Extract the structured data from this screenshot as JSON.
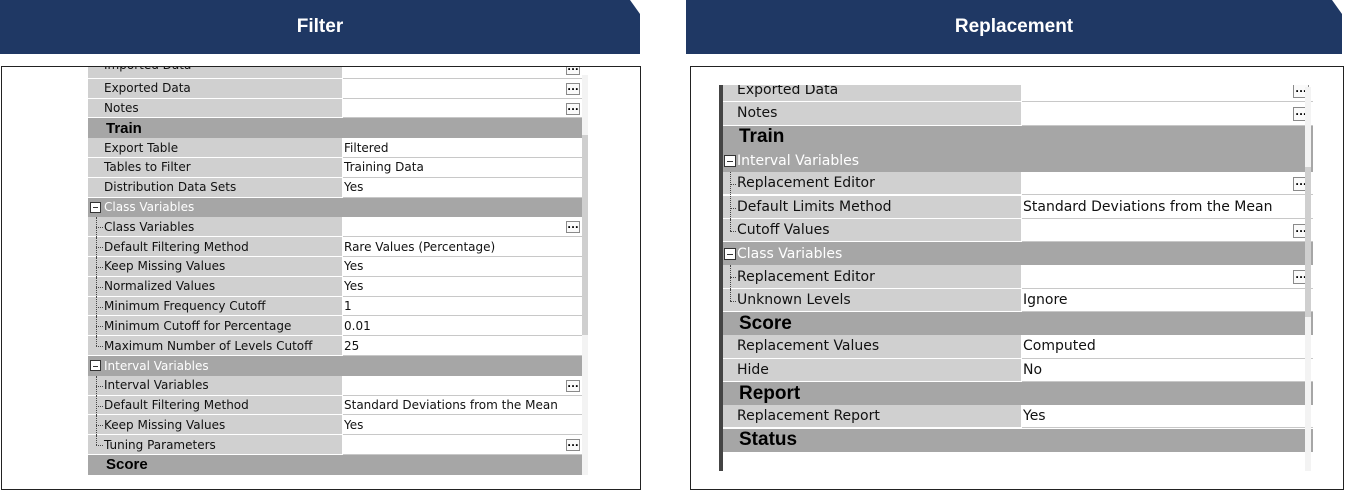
{
  "headers": {
    "left": "Filter",
    "right": "Replacement"
  },
  "ellipsis": "...",
  "filter_rows": [
    {
      "kind": "item",
      "name": "Imported Data",
      "value": "",
      "button": true,
      "partial": true
    },
    {
      "kind": "item",
      "name": "Exported Data",
      "value": "",
      "button": true
    },
    {
      "kind": "item",
      "name": "Notes",
      "value": "",
      "button": true
    },
    {
      "kind": "section",
      "name": "Train"
    },
    {
      "kind": "item",
      "name": "Export Table",
      "value": "Filtered"
    },
    {
      "kind": "item",
      "name": "Tables to Filter",
      "value": "Training Data"
    },
    {
      "kind": "item",
      "name": "Distribution Data Sets",
      "value": "Yes"
    },
    {
      "kind": "group",
      "name": "Class Variables"
    },
    {
      "kind": "item",
      "name": "Class Variables",
      "value": "",
      "button": true,
      "child": true
    },
    {
      "kind": "item",
      "name": "Default Filtering Method",
      "value": "Rare Values (Percentage)",
      "child": true
    },
    {
      "kind": "item",
      "name": "Keep Missing Values",
      "value": "Yes",
      "child": true
    },
    {
      "kind": "item",
      "name": "Normalized Values",
      "value": "Yes",
      "child": true
    },
    {
      "kind": "item",
      "name": "Minimum Frequency Cutoff",
      "value": "1",
      "child": true
    },
    {
      "kind": "item",
      "name": "Minimum Cutoff for Percentage",
      "value": "0.01",
      "child": true
    },
    {
      "kind": "item",
      "name": "Maximum Number of Levels Cutoff",
      "value": "25",
      "child": true,
      "last": true
    },
    {
      "kind": "group",
      "name": "Interval Variables"
    },
    {
      "kind": "item",
      "name": "Interval Variables",
      "value": "",
      "button": true,
      "child": true
    },
    {
      "kind": "item",
      "name": "Default Filtering Method",
      "value": "Standard Deviations from the Mean",
      "child": true
    },
    {
      "kind": "item",
      "name": "Keep Missing Values",
      "value": "Yes",
      "child": true
    },
    {
      "kind": "item",
      "name": "Tuning Parameters",
      "value": "",
      "button": true,
      "child": true,
      "last": true
    },
    {
      "kind": "section",
      "name": "Score"
    }
  ],
  "replacement_rows": [
    {
      "kind": "item",
      "name": "Exported Data",
      "value": "",
      "button": true
    },
    {
      "kind": "item",
      "name": "Notes",
      "value": "",
      "button": true
    },
    {
      "kind": "section",
      "name": "Train"
    },
    {
      "kind": "group",
      "name": "Interval Variables"
    },
    {
      "kind": "item",
      "name": "Replacement Editor",
      "value": "",
      "button": true,
      "child": true
    },
    {
      "kind": "item",
      "name": "Default Limits Method",
      "value": "Standard Deviations from the Mean",
      "child": true
    },
    {
      "kind": "item",
      "name": "Cutoff Values",
      "value": "",
      "button": true,
      "child": true,
      "last": true
    },
    {
      "kind": "group",
      "name": "Class Variables"
    },
    {
      "kind": "item",
      "name": "Replacement Editor",
      "value": "",
      "button": true,
      "child": true
    },
    {
      "kind": "item",
      "name": "Unknown Levels",
      "value": "Ignore",
      "child": true,
      "last": true
    },
    {
      "kind": "section",
      "name": "Score"
    },
    {
      "kind": "item",
      "name": "Replacement Values",
      "value": "Computed"
    },
    {
      "kind": "item",
      "name": "Hide",
      "value": "No"
    },
    {
      "kind": "section",
      "name": "Report"
    },
    {
      "kind": "item",
      "name": "Replacement Report",
      "value": "Yes"
    },
    {
      "kind": "section",
      "name": "Status"
    }
  ]
}
